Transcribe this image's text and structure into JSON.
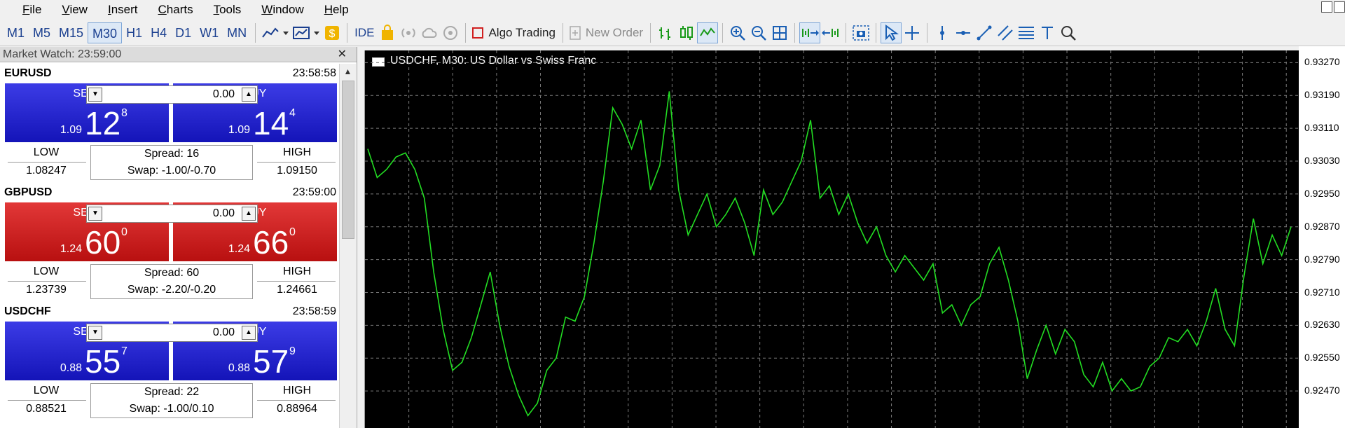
{
  "menu": [
    {
      "first": "F",
      "rest": "ile"
    },
    {
      "first": "V",
      "rest": "iew"
    },
    {
      "first": "I",
      "rest": "nsert"
    },
    {
      "first": "C",
      "rest": "harts"
    },
    {
      "first": "T",
      "rest": "ools"
    },
    {
      "first": "W",
      "rest": "indow"
    },
    {
      "first": "H",
      "rest": "elp"
    }
  ],
  "toolbar": {
    "timeframes": [
      "M1",
      "M5",
      "M15",
      "M30",
      "H1",
      "H4",
      "D1",
      "W1",
      "MN"
    ],
    "active_timeframe": "M30",
    "ide_label": "IDE",
    "algo_label": "Algo Trading",
    "new_order_label": "New Order"
  },
  "market_watch": {
    "title": "Market Watch: 23:59:00",
    "lot_value": "0.00",
    "sell_label": "SELL",
    "buy_label": "BUY",
    "low_label": "LOW",
    "high_label": "HIGH",
    "quotes": [
      {
        "symbol": "EURUSD",
        "time": "23:58:58",
        "color": "blue",
        "sell_prefix": "1.09",
        "sell_big": "12",
        "sell_sup": "8",
        "buy_prefix": "1.09",
        "buy_big": "14",
        "buy_sup": "4",
        "low": "1.08247",
        "high": "1.09150",
        "spread": "Spread: 16",
        "swap": "Swap: -1.00/-0.70"
      },
      {
        "symbol": "GBPUSD",
        "time": "23:59:00",
        "color": "red",
        "sell_prefix": "1.24",
        "sell_big": "60",
        "sell_sup": "0",
        "buy_prefix": "1.24",
        "buy_big": "66",
        "buy_sup": "0",
        "low": "1.23739",
        "high": "1.24661",
        "spread": "Spread: 60",
        "swap": "Swap: -2.20/-0.20"
      },
      {
        "symbol": "USDCHF",
        "time": "23:58:59",
        "color": "blue",
        "sell_prefix": "0.88",
        "sell_big": "55",
        "sell_sup": "7",
        "buy_prefix": "0.88",
        "buy_big": "57",
        "buy_sup": "9",
        "low": "0.88521",
        "high": "0.88964",
        "spread": "Spread: 22",
        "swap": "Swap: -1.00/0.10"
      }
    ]
  },
  "chart": {
    "title": "USDCHF, M30:  US Dollar vs Swiss Franc",
    "line_color": "#22dd22",
    "grid_color": "#7a7a7a",
    "price_ticks": [
      "0.93270",
      "0.93190",
      "0.93110",
      "0.93030",
      "0.92950",
      "0.92870",
      "0.92790",
      "0.92710",
      "0.92630",
      "0.92550",
      "0.92470"
    ]
  },
  "chart_data": {
    "type": "line",
    "ylim": [
      0.9239,
      0.9331
    ],
    "series": [
      {
        "values": [
          0.9306,
          0.9299,
          0.9301,
          0.9304,
          0.9305,
          0.9301,
          0.9294,
          0.9276,
          0.9262,
          0.9252,
          0.9254,
          0.926,
          0.9268,
          0.9276,
          0.9263,
          0.9253,
          0.9246,
          0.9241,
          0.9244,
          0.9252,
          0.9255,
          0.9265,
          0.9264,
          0.927,
          0.9283,
          0.9298,
          0.9316,
          0.9312,
          0.9306,
          0.9313,
          0.9296,
          0.9302,
          0.932,
          0.9296,
          0.9285,
          0.929,
          0.9295,
          0.9287,
          0.929,
          0.9294,
          0.9288,
          0.928,
          0.9296,
          0.929,
          0.9293,
          0.9298,
          0.9303,
          0.9313,
          0.9294,
          0.9297,
          0.929,
          0.9295,
          0.9288,
          0.9283,
          0.9287,
          0.928,
          0.9276,
          0.928,
          0.9277,
          0.9274,
          0.9278,
          0.9266,
          0.9268,
          0.9263,
          0.9268,
          0.927,
          0.9278,
          0.9282,
          0.9274,
          0.9264,
          0.925,
          0.9257,
          0.9263,
          0.9256,
          0.9262,
          0.9259,
          0.9251,
          0.9248,
          0.9254,
          0.9247,
          0.925,
          0.9247,
          0.9248,
          0.9253,
          0.9255,
          0.926,
          0.9259,
          0.9262,
          0.9258,
          0.9264,
          0.9272,
          0.9262,
          0.9258,
          0.9275,
          0.9289,
          0.9278,
          0.9285,
          0.928,
          0.9287
        ]
      }
    ]
  }
}
